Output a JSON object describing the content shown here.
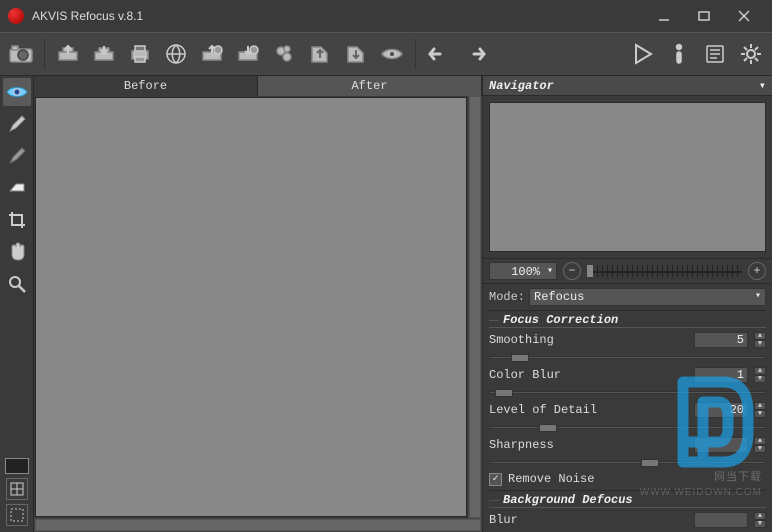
{
  "title": "AKVIS Refocus v.8.1",
  "tabs": {
    "before": "Before",
    "after": "After"
  },
  "navigator": {
    "title": "Navigator",
    "zoom": "100%"
  },
  "mode": {
    "label": "Mode:",
    "value": "Refocus"
  },
  "groups": {
    "focus_correction": "Focus Correction",
    "background_defocus": "Background Defocus"
  },
  "params": {
    "smoothing": {
      "label": "Smoothing",
      "value": "5",
      "pos": 8
    },
    "color_blur": {
      "label": "Color Blur",
      "value": "1",
      "pos": 2
    },
    "level_of_detail": {
      "label": "Level of Detail",
      "value": "20",
      "pos": 18
    },
    "sharpness": {
      "label": "Sharpness",
      "value": "",
      "pos": 55
    },
    "blur": {
      "label": "Blur",
      "value": "",
      "pos": 0
    }
  },
  "remove_noise": {
    "label": "Remove Noise",
    "checked": "✓"
  },
  "watermark": {
    "text": "网当下载",
    "url": "WWW.WEIDOWN.COM"
  }
}
